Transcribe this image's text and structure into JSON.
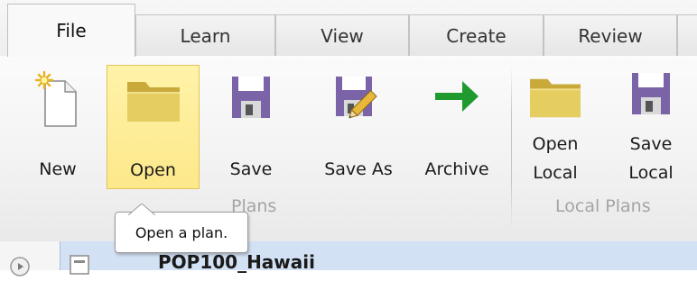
{
  "tabs": [
    "File",
    "Learn",
    "View",
    "Create",
    "Review"
  ],
  "groups": {
    "plans": {
      "label": "Plans",
      "buttons": {
        "new": "New",
        "open": "Open",
        "save": "Save",
        "save_as": "Save As",
        "archive": "Archive"
      }
    },
    "local_plans": {
      "label": "Local Plans",
      "buttons": {
        "open_local": [
          "Open",
          "Local"
        ],
        "save_local": [
          "Save",
          "Local"
        ]
      }
    }
  },
  "tooltip": "Open a plan.",
  "list": {
    "row_title": "POP100_Hawaii"
  },
  "icons": {
    "new": "new-document-icon",
    "open": "folder-icon",
    "save": "floppy-disk-icon",
    "save_as": "floppy-pencil-icon",
    "archive": "green-arrow-icon"
  },
  "colors": {
    "hover_fill": "#fde88a",
    "hover_border": "#e2c35a",
    "floppy": "#7b63a8",
    "folder": "#e3c95a",
    "arrow": "#1f9a2f",
    "group_label": "#a4a4a4",
    "selected_row": "#d3e1f4"
  }
}
